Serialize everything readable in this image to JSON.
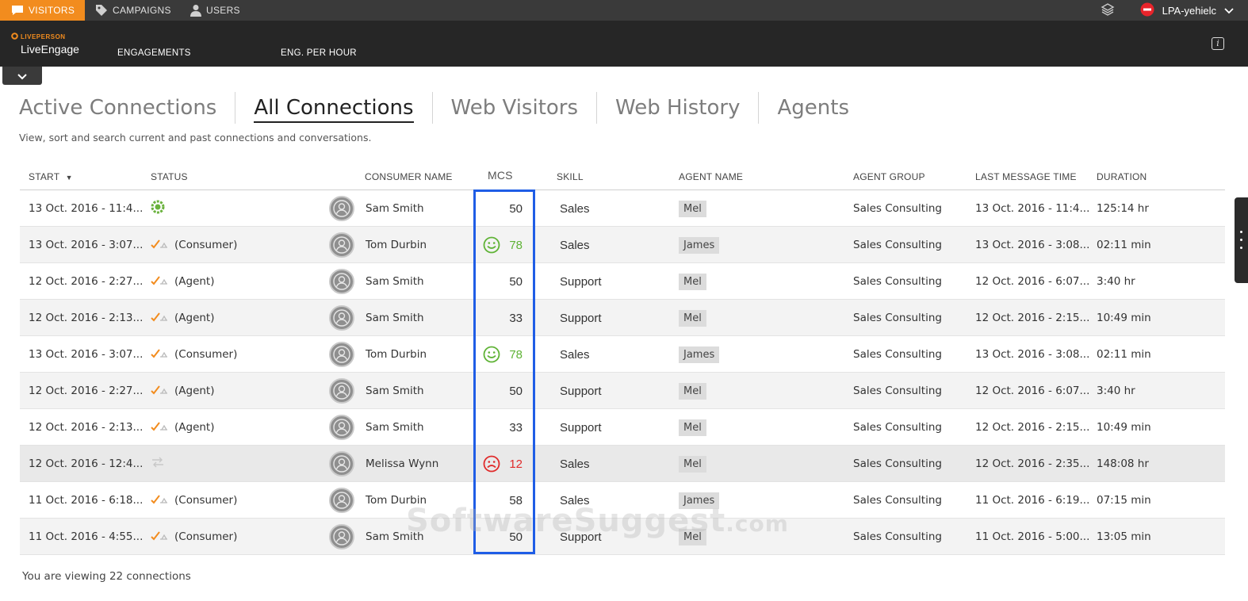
{
  "topbar": {
    "tabs": [
      {
        "label": "VISITORS",
        "icon": "chat-icon"
      },
      {
        "label": "CAMPAIGNS",
        "icon": "tag-icon"
      },
      {
        "label": "USERS",
        "icon": "user-icon"
      }
    ],
    "user": "LPA-yehielc"
  },
  "header": {
    "brand_small": "LIVEPERSON",
    "brand": "LiveEngage",
    "nav": [
      "ENGAGEMENTS",
      "ENG. PER HOUR"
    ]
  },
  "tabs": [
    "Active Connections",
    "All Connections",
    "Web Visitors",
    "Web History",
    "Agents"
  ],
  "active_tab": "All Connections",
  "subtitle": "View, sort and search current and past connections and conversations.",
  "columns": {
    "start": "START",
    "status": "STATUS",
    "consumer": "CONSUMER NAME",
    "mcs": "MCS",
    "skill": "SKILL",
    "agent": "AGENT NAME",
    "group": "AGENT GROUP",
    "last": "LAST MESSAGE TIME",
    "duration": "DURATION"
  },
  "rows": [
    {
      "start": "13 Oct. 2016 - 11:4...",
      "status": "",
      "status_icon": "active-icon",
      "consumer": "Sam Smith",
      "mcs": "50",
      "mood": "none",
      "skill": "Sales",
      "agent": "Mel",
      "group": "Sales Consulting",
      "last": "13 Oct. 2016 - 11:4...",
      "duration": "125:14 hr"
    },
    {
      "start": "13 Oct. 2016 - 3:07...",
      "status": "(Consumer)",
      "status_icon": "ended-icon",
      "consumer": "Tom Durbin",
      "mcs": "78",
      "mood": "positive",
      "skill": "Sales",
      "agent": "James",
      "group": "Sales Consulting",
      "last": "13 Oct. 2016 - 3:08...",
      "duration": "02:11 min"
    },
    {
      "start": "12 Oct. 2016 - 2:27...",
      "status": "(Agent)",
      "status_icon": "ended-icon",
      "consumer": "Sam Smith",
      "mcs": "50",
      "mood": "none",
      "skill": "Support",
      "agent": "Mel",
      "group": "Sales Consulting",
      "last": "12 Oct. 2016 - 6:07...",
      "duration": "3:40 hr"
    },
    {
      "start": "12 Oct. 2016 - 2:13...",
      "status": "(Agent)",
      "status_icon": "ended-icon",
      "consumer": "Sam Smith",
      "mcs": "33",
      "mood": "none",
      "skill": "Support",
      "agent": "Mel",
      "group": "Sales Consulting",
      "last": "12 Oct. 2016 - 2:15...",
      "duration": "10:49 min"
    },
    {
      "start": "13 Oct. 2016 - 3:07...",
      "status": "(Consumer)",
      "status_icon": "ended-icon",
      "consumer": "Tom Durbin",
      "mcs": "78",
      "mood": "positive",
      "skill": "Sales",
      "agent": "James",
      "group": "Sales Consulting",
      "last": "13 Oct. 2016 - 3:08...",
      "duration": "02:11 min"
    },
    {
      "start": "12 Oct. 2016 - 2:27...",
      "status": "(Agent)",
      "status_icon": "ended-icon",
      "consumer": "Sam Smith",
      "mcs": "50",
      "mood": "none",
      "skill": "Support",
      "agent": "Mel",
      "group": "Sales Consulting",
      "last": "12 Oct. 2016 - 6:07...",
      "duration": "3:40 hr"
    },
    {
      "start": "12 Oct. 2016 - 2:13...",
      "status": "(Agent)",
      "status_icon": "ended-icon",
      "consumer": "Sam Smith",
      "mcs": "33",
      "mood": "none",
      "skill": "Support",
      "agent": "Mel",
      "group": "Sales Consulting",
      "last": "12 Oct. 2016 - 2:15...",
      "duration": "10:49 min"
    },
    {
      "start": "12 Oct. 2016 - 12:4...",
      "status": "",
      "status_icon": "transfer-icon",
      "consumer": "Melissa Wynn",
      "mcs": "12",
      "mood": "negative",
      "skill": "Sales",
      "agent": "Mel",
      "group": "Sales Consulting",
      "last": "12 Oct. 2016 - 2:35...",
      "duration": "148:08 hr"
    },
    {
      "start": "11 Oct. 2016 - 6:18...",
      "status": "(Consumer)",
      "status_icon": "ended-icon",
      "consumer": "Tom Durbin",
      "mcs": "58",
      "mood": "none",
      "skill": "Sales",
      "agent": "James",
      "group": "Sales Consulting",
      "last": "11 Oct. 2016 - 6:19...",
      "duration": "07:15 min"
    },
    {
      "start": "11 Oct. 2016 - 4:55...",
      "status": "(Consumer)",
      "status_icon": "ended-icon",
      "consumer": "Sam Smith",
      "mcs": "50",
      "mood": "none",
      "skill": "Support",
      "agent": "Mel",
      "group": "Sales Consulting",
      "last": "11 Oct. 2016 - 5:00...",
      "duration": "13:05 min"
    }
  ],
  "footer": "You are viewing 22 connections",
  "watermark": {
    "main": "SoftwareSuggest",
    "suffix": ".com"
  },
  "colors": {
    "accent": "#f28c1e",
    "positive": "#5fb336",
    "negative": "#e02b2b",
    "highlight_box": "#1f5de6"
  }
}
